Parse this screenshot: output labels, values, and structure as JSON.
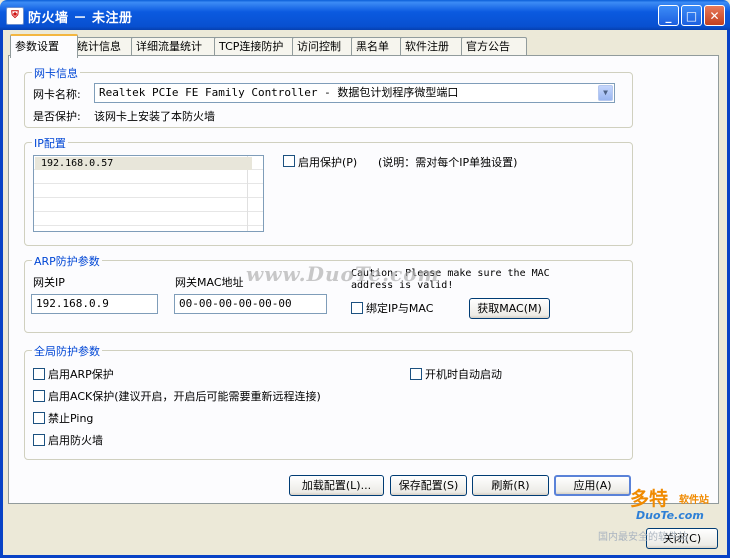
{
  "window": {
    "title": "防火墙 － 未注册",
    "controls": {
      "minimize": "_",
      "maximize": "□",
      "close": "✕"
    }
  },
  "tabs": [
    {
      "label": "参数设置",
      "active": true
    },
    {
      "label": "统计信息"
    },
    {
      "label": "详细流量统计"
    },
    {
      "label": "TCP连接防护"
    },
    {
      "label": "访问控制"
    },
    {
      "label": "黑名单"
    },
    {
      "label": "软件注册"
    },
    {
      "label": "官方公告"
    }
  ],
  "nic": {
    "group_title": "网卡信息",
    "name_label": "网卡名称:",
    "name_value": "Realtek PCIe FE Family Controller - 数据包计划程序微型端口",
    "protect_label": "是否保护:",
    "protect_value": "该网卡上安装了本防火墙"
  },
  "ip": {
    "group_title": "IP配置",
    "list": [
      "192.168.0.57"
    ],
    "enable_label": "启用保护(P)",
    "note": "(说明：需对每个IP单独设置)"
  },
  "arp": {
    "group_title": "ARP防护参数",
    "gateway_ip_label": "网关IP",
    "gateway_ip_value": "192.168.0.9",
    "gateway_mac_label": "网关MAC地址",
    "gateway_mac_value": "00-00-00-00-00-00",
    "caution_line1": "Caution: Please make sure the MAC",
    "caution_line2": "address is valid!",
    "bind_label": "绑定IP与MAC",
    "get_mac_button": "获取MAC(M)"
  },
  "global": {
    "group_title": "全局防护参数",
    "options": [
      "启用ARP保护",
      "启用ACK保护(建议开启，开启后可能需要重新远程连接)",
      "禁止Ping",
      "启用防火墙"
    ],
    "autostart": "开机时自动启动"
  },
  "buttons": {
    "load": "加载配置(L)...",
    "save": "保存配置(S)",
    "refresh": "刷新(R)",
    "apply": "应用(A)",
    "close": "关闭(C)"
  },
  "watermark": "www.DuoTe.com",
  "logo": {
    "main": "多特",
    "suffix": "软件站",
    "domain": "DuoTe.com",
    "slogan": "国内最安全的软件站"
  },
  "colors": {
    "titlebar": "#0a5fd8",
    "group_title": "#0046d5",
    "tab_highlight": "#f3b640",
    "logo": "#f08a00"
  }
}
